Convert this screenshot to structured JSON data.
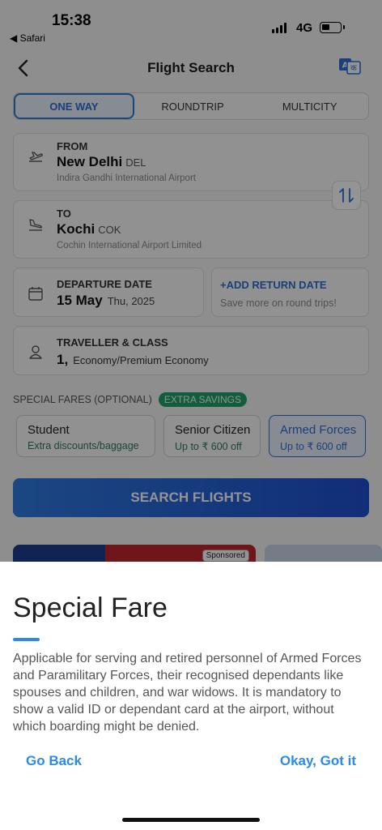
{
  "status_bar": {
    "time": "15:38",
    "back_app": "◀ Safari",
    "network": "4G",
    "battery_level": 0.35
  },
  "header": {
    "title": "Flight Search",
    "back_icon": "chevron-left-icon",
    "language_icon": "translate-icon"
  },
  "trip_tabs": [
    {
      "label": "ONE WAY",
      "active": true
    },
    {
      "label": "ROUNDTRIP",
      "active": false
    },
    {
      "label": "MULTICITY",
      "active": false
    }
  ],
  "from": {
    "label": "FROM",
    "city": "New Delhi",
    "code": "DEL",
    "airport": "Indira Gandhi International Airport"
  },
  "to": {
    "label": "TO",
    "city": "Kochi",
    "code": "COK",
    "airport": "Cochin International Airport Limited"
  },
  "departure": {
    "label": "DEPARTURE DATE",
    "date": "15 May",
    "day_year": "Thu, 2025"
  },
  "return": {
    "link": "+ADD RETURN DATE",
    "hint": "Save more on round trips!"
  },
  "traveller": {
    "label": "TRAVELLER & CLASS",
    "count": "1,",
    "class": "Economy/Premium Economy"
  },
  "special_fares": {
    "label": "SPECIAL FARES (OPTIONAL)",
    "badge": "EXTRA SAVINGS",
    "options": [
      {
        "name": "Student",
        "sub": "Extra discounts/baggage",
        "selected": false
      },
      {
        "name": "Senior Citizen",
        "sub": "Up to ₹ 600 off",
        "selected": false
      },
      {
        "name": "Armed Forces",
        "sub": "Up to ₹ 600 off",
        "selected": true
      }
    ]
  },
  "search_button": "SEARCH FLIGHTS",
  "banner": {
    "sponsored": "Sponsored"
  },
  "sheet": {
    "title": "Special Fare",
    "body": "Applicable for serving and retired personnel of Armed Forces and Paramilitary Forces, their recognised dependants like spouses and children, and war widows. It is mandatory to show a valid ID or dependant card at the airport, without which boarding might be denied.",
    "go_back": "Go Back",
    "okay": "Okay, Got it"
  },
  "colors": {
    "accent": "#2b8be6",
    "tab_active": "#2b6fd4",
    "badge_green": "#22a06b"
  }
}
